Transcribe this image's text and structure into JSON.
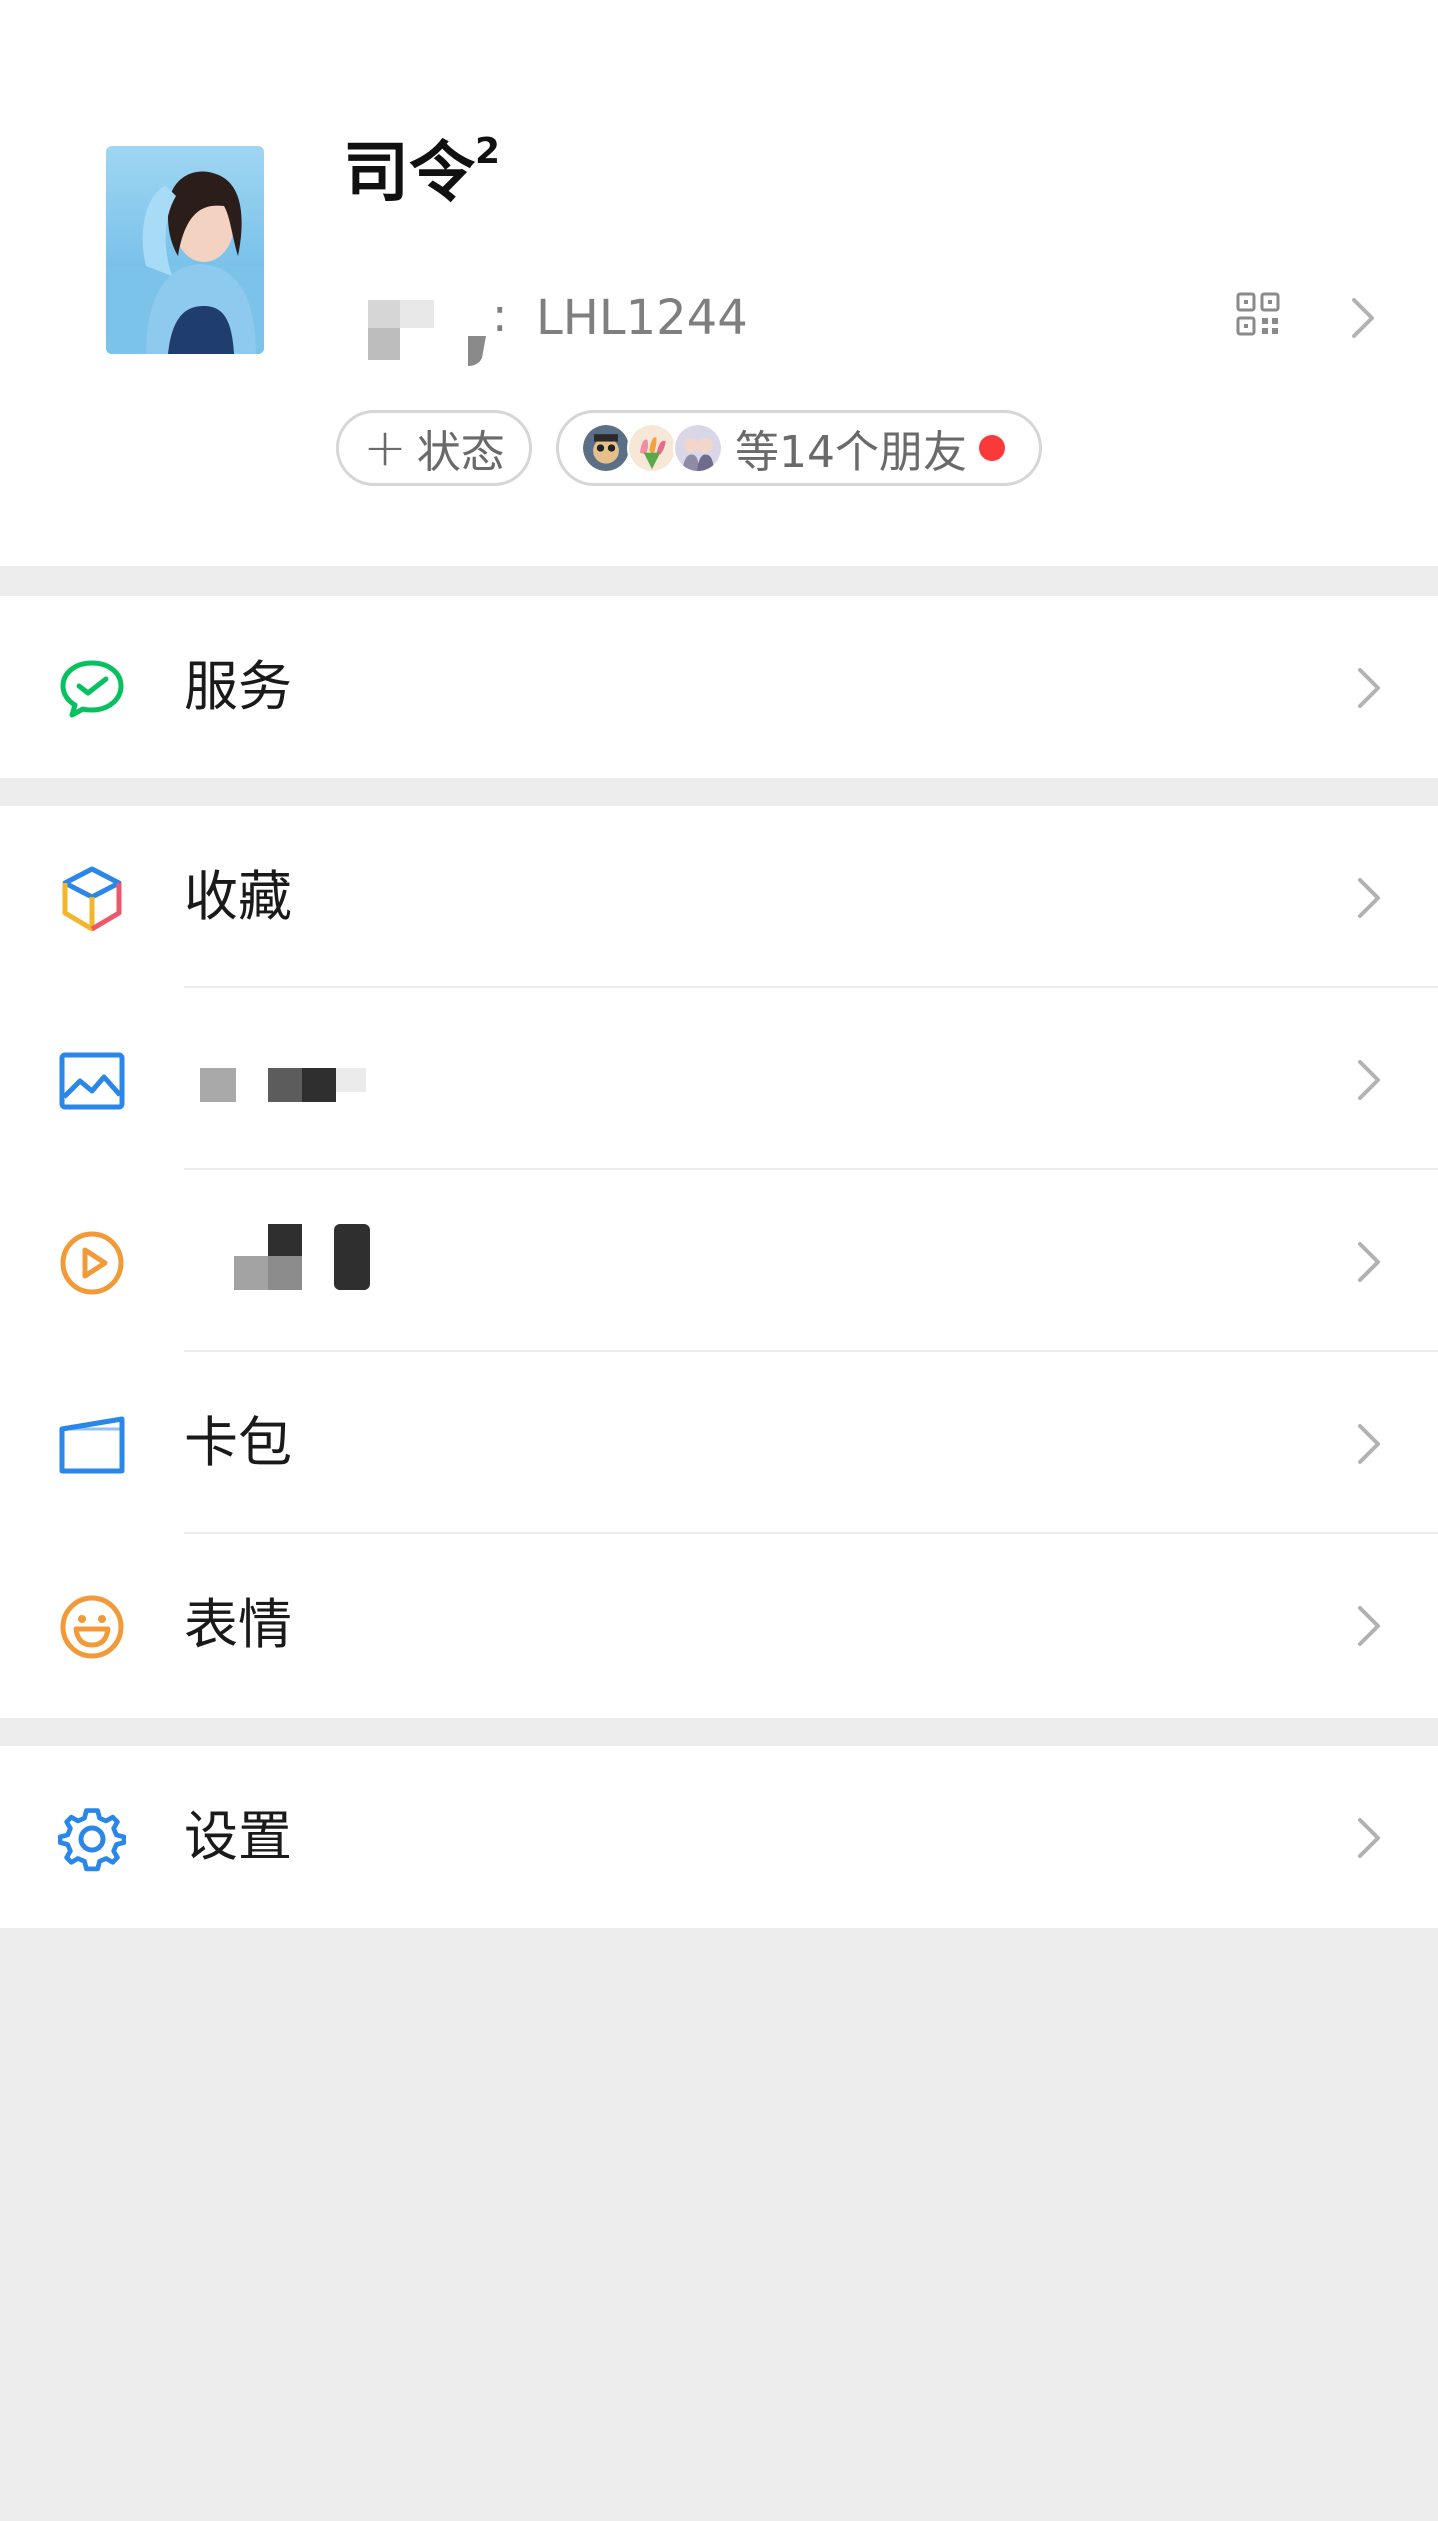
{
  "profile": {
    "nickname": "司令",
    "nickname_superscript": "2",
    "wechat_id_value": "LHL1244",
    "wechat_id_colon": ":",
    "status_button": {
      "plus": "+",
      "label": "状态"
    },
    "friends_pill": {
      "label": "等14个朋友",
      "has_red_dot": true
    }
  },
  "menu": {
    "services": {
      "label": "服务",
      "icon": "wechat-pay-icon",
      "color": "#07c160"
    },
    "favorites": {
      "label": "收藏",
      "icon": "cube-icon"
    },
    "moments": {
      "label": "",
      "icon": "image-icon",
      "color": "#2a86e8"
    },
    "channels": {
      "label": "",
      "icon": "play-circle-icon",
      "color": "#f29a38"
    },
    "cards": {
      "label": "卡包",
      "icon": "wallet-icon",
      "color": "#2a86e8"
    },
    "stickers": {
      "label": "表情",
      "icon": "smile-icon",
      "color": "#f29a38"
    },
    "settings": {
      "label": "设置",
      "icon": "gear-icon",
      "color": "#2a86e8"
    }
  }
}
